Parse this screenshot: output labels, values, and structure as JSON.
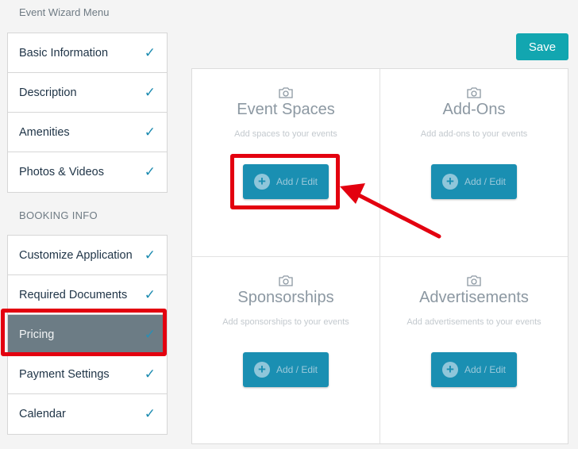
{
  "wizard": {
    "title": "Event Wizard Menu",
    "section_label": "BOOKING INFO"
  },
  "menu_group1": [
    {
      "label": "Basic Information",
      "check": "✓"
    },
    {
      "label": "Description",
      "check": "✓"
    },
    {
      "label": "Amenities",
      "check": "✓"
    },
    {
      "label": "Photos & Videos",
      "check": "✓"
    }
  ],
  "menu_group2": [
    {
      "label": "Customize Application",
      "check": "✓"
    },
    {
      "label": "Required Documents",
      "check": "✓"
    },
    {
      "label": "Pricing",
      "check": "✓"
    },
    {
      "label": "Payment Settings",
      "check": "✓"
    },
    {
      "label": "Calendar",
      "check": "✓"
    }
  ],
  "save_label": "Save",
  "tiles": [
    {
      "title": "Event Spaces",
      "subtitle": "Add spaces to your events",
      "button": "Add / Edit",
      "icon": "camera-icon"
    },
    {
      "title": "Add-Ons",
      "subtitle": "Add add-ons to your events",
      "button": "Add / Edit",
      "icon": "camera-icon"
    },
    {
      "title": "Sponsorships",
      "subtitle": "Add sponsorships to your events",
      "button": "Add / Edit",
      "icon": "camera-icon"
    },
    {
      "title": "Advertisements",
      "subtitle": "Add advertisements to your events",
      "button": "Add / Edit",
      "icon": "camera-icon"
    }
  ],
  "colors": {
    "accent": "#12a6b0",
    "add_button": "#1a8fb2",
    "active_item": "#6c7c85",
    "annotation": "#e3000f",
    "check": "#1c8bb0"
  }
}
